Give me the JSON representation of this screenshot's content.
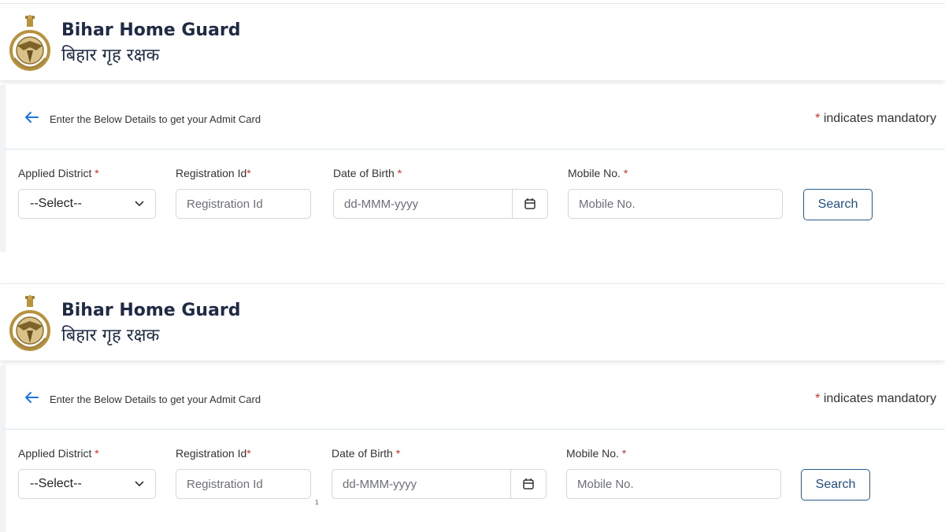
{
  "sections": [
    {
      "brand": {
        "title_en": "Bihar Home Guard",
        "title_hi": "बिहार गृह रक्षक",
        "logo_icon": "bihar-home-guard-emblem-icon"
      },
      "form_header": {
        "back_icon": "arrow-left-icon",
        "instruction": "Enter the Below Details to get your Admit Card",
        "mandatory_note": "indicates mandatory",
        "mandatory_symbol": "*"
      },
      "fields": {
        "district": {
          "label": "Applied District",
          "required_mark": "*",
          "selected": "--Select--"
        },
        "registration": {
          "label": "Registration Id",
          "required_mark": "*",
          "placeholder": "Registration Id"
        },
        "dob": {
          "label": "Date of Birth",
          "required_mark": "*",
          "placeholder": "dd-MMM-yyyy",
          "icon": "calendar-icon"
        },
        "mobile": {
          "label": "Mobile No.",
          "required_mark": "*",
          "placeholder": "Mobile No."
        }
      },
      "search_label": "Search"
    },
    {
      "brand": {
        "title_en": "Bihar Home Guard",
        "title_hi": "बिहार गृह रक्षक",
        "logo_icon": "bihar-home-guard-emblem-icon"
      },
      "form_header": {
        "back_icon": "arrow-left-icon",
        "instruction": "Enter the Below Details to get your Admit Card",
        "mandatory_note": "indicates mandatory",
        "mandatory_symbol": "*"
      },
      "fields": {
        "district": {
          "label": "Applied District",
          "required_mark": "*",
          "selected": "--Select--"
        },
        "registration": {
          "label": "Registration Id",
          "required_mark": "*",
          "placeholder": "Registration Id"
        },
        "dob": {
          "label": "Date of Birth",
          "required_mark": "*",
          "placeholder": "dd-MMM-yyyy",
          "icon": "calendar-icon"
        },
        "mobile": {
          "label": "Mobile No.",
          "required_mark": "*",
          "placeholder": "Mobile No."
        }
      },
      "search_label": "Search",
      "stray_mark": "1"
    }
  ],
  "colors": {
    "accent": "#2a5d8f",
    "required": "#d32f2f",
    "divider": "#d7e8ea",
    "back_arrow": "#1e73e8"
  }
}
